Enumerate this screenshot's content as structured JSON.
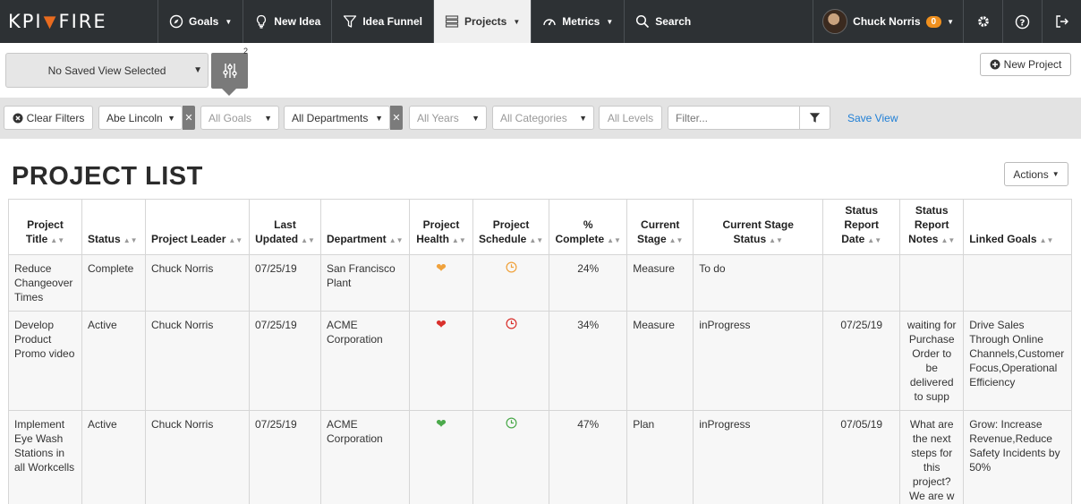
{
  "nav": {
    "logo_left": "KPI",
    "logo_right": "FIRE",
    "items": [
      {
        "label": "Goals",
        "icon": "compass-icon",
        "caret": true
      },
      {
        "label": "New Idea",
        "icon": "lightbulb-icon",
        "caret": false
      },
      {
        "label": "Idea Funnel",
        "icon": "funnel-icon",
        "caret": false
      },
      {
        "label": "Projects",
        "icon": "projects-icon",
        "caret": true,
        "active": true
      },
      {
        "label": "Metrics",
        "icon": "gauge-icon",
        "caret": true
      },
      {
        "label": "Search",
        "icon": "search-icon",
        "caret": false
      }
    ],
    "user_name": "Chuck Norris",
    "notification_count": "0"
  },
  "viewbar": {
    "saved_view": "No Saved View Selected",
    "filter_count": "2",
    "new_project_label": "New Project"
  },
  "filters": {
    "clear_label": "Clear Filters",
    "leader": "Abe Lincoln",
    "goals": "All Goals",
    "departments": "All Departments",
    "years": "All Years",
    "categories": "All Categories",
    "levels": "All Levels",
    "search_placeholder": "Filter...",
    "save_view_label": "Save View"
  },
  "page": {
    "title": "PROJECT LIST",
    "actions_label": "Actions"
  },
  "table": {
    "columns": [
      "Project Title",
      "Status",
      "Project Leader",
      "Last Updated",
      "Department",
      "Project Health",
      "Project Schedule",
      "% Complete",
      "Current Stage",
      "Current Stage Status",
      "Status Report Date",
      "Status Report Notes",
      "Linked Goals"
    ],
    "rows": [
      {
        "title": "Reduce Changeover Times",
        "status": "Complete",
        "leader": "Chuck Norris",
        "updated": "07/25/19",
        "department": "San Francisco Plant",
        "health": "orange-heart-icon",
        "health_color": "#f0a23c",
        "schedule_color": "#f0a23c",
        "complete": "24%",
        "stage": "Measure",
        "stage_status": "To do",
        "report_date": "",
        "notes": "",
        "goals": ""
      },
      {
        "title": "Develop Product Promo video",
        "status": "Active",
        "leader": "Chuck Norris",
        "updated": "07/25/19",
        "department": "ACME Corporation",
        "health": "red-heart-icon",
        "health_color": "#d9302c",
        "schedule_color": "#d9302c",
        "complete": "34%",
        "stage": "Measure",
        "stage_status": "inProgress",
        "report_date": "07/25/19",
        "notes": "waiting for Purchase Order to be delivered to supp",
        "goals": "Drive Sales Through Online Channels,Customer Focus,Operational Efficiency"
      },
      {
        "title": "Implement Eye Wash Stations in all Workcells",
        "status": "Active",
        "leader": "Chuck Norris",
        "updated": "07/25/19",
        "department": "ACME Corporation",
        "health": "green-heart-icon",
        "health_color": "#4caa4c",
        "schedule_color": "#4caa4c",
        "complete": "47%",
        "stage": "Plan",
        "stage_status": "inProgress",
        "report_date": "07/05/19",
        "notes": "What are the next steps for this project? We are w",
        "goals": "Grow: Increase Revenue,Reduce Safety Incidents by 50%"
      }
    ]
  }
}
